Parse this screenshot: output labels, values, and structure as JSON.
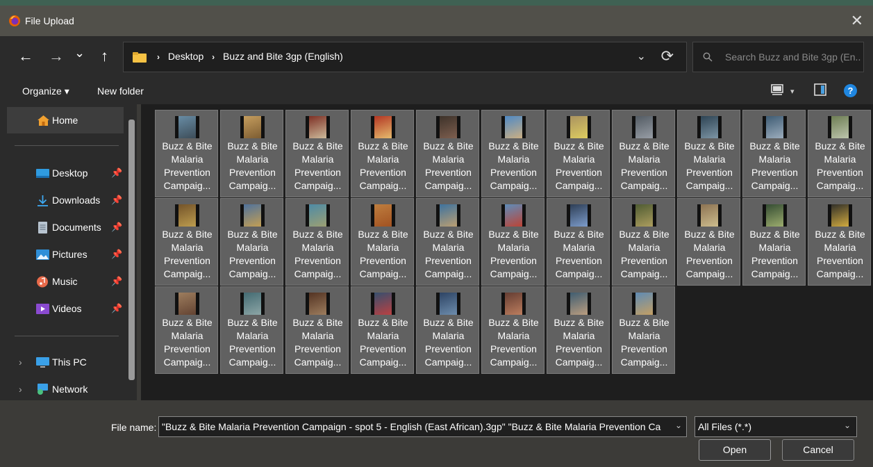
{
  "window": {
    "title": "File Upload",
    "close_glyph": "✕"
  },
  "nav": {
    "back": "←",
    "forward": "→",
    "recent": "⌄",
    "up": "↑"
  },
  "address": {
    "crumbs": [
      "Desktop",
      "Buzz and Bite 3gp (English)"
    ],
    "sep": "›",
    "dropdown_glyph": "⌄",
    "refresh_glyph": "⟳"
  },
  "search": {
    "placeholder": "Search Buzz and Bite 3gp (En..."
  },
  "toolbar": {
    "organize": "Organize ▾",
    "new_folder": "New folder",
    "view_caret": "▾",
    "help": "?"
  },
  "sidebar": {
    "home": "Home",
    "pinned": [
      {
        "label": "Desktop",
        "icon": "desktop-icon"
      },
      {
        "label": "Downloads",
        "icon": "downloads-icon"
      },
      {
        "label": "Documents",
        "icon": "documents-icon"
      },
      {
        "label": "Pictures",
        "icon": "pictures-icon"
      },
      {
        "label": "Music",
        "icon": "music-icon"
      },
      {
        "label": "Videos",
        "icon": "videos-icon"
      }
    ],
    "pin_glyph": "📌",
    "expand_glyph": "›",
    "this_pc": "This PC",
    "network": "Network"
  },
  "files": {
    "caption_lines": [
      "Buzz & Bite",
      "Malaria",
      "Prevention",
      "Campaig..."
    ],
    "count": 30,
    "thumb_colors": [
      [
        "#6a8fa8",
        "#3b4a55"
      ],
      [
        "#c8a060",
        "#7a5a30"
      ],
      [
        "#7a2a20",
        "#d0c0a0"
      ],
      [
        "#b03020",
        "#e8c070"
      ],
      [
        "#3a3028",
        "#806050"
      ],
      [
        "#4a88c8",
        "#d0b080"
      ],
      [
        "#a89060",
        "#e0d060"
      ],
      [
        "#505860",
        "#9aa0a8"
      ],
      [
        "#2a4050",
        "#8098a8"
      ],
      [
        "#3a5870",
        "#a0b0c0"
      ],
      [
        "#6a7a50",
        "#c0c8b0"
      ],
      [
        "#705028",
        "#c0a050"
      ],
      [
        "#4a70a0",
        "#c8a050"
      ],
      [
        "#4a8aa8",
        "#a0a070"
      ],
      [
        "#c08040",
        "#a05020"
      ],
      [
        "#3870a0",
        "#c0a070"
      ],
      [
        "#5a90c0",
        "#c04030"
      ],
      [
        "#2a3a50",
        "#80a0d0"
      ],
      [
        "#4a5830",
        "#b0a060"
      ],
      [
        "#8a7050",
        "#d0c090"
      ],
      [
        "#304830",
        "#a0b070"
      ],
      [
        "#2a2a28",
        "#d8b040"
      ],
      [
        "#a08060",
        "#604030"
      ],
      [
        "#406870",
        "#90a8a8"
      ],
      [
        "#503020",
        "#a08060"
      ],
      [
        "#305070",
        "#c04040"
      ],
      [
        "#2a4060",
        "#7090b0"
      ],
      [
        "#603a30",
        "#c08060"
      ],
      [
        "#3a5a70",
        "#c0a080"
      ],
      [
        "#5a8ab8",
        "#c8a060"
      ]
    ],
    "selected": true
  },
  "footer": {
    "file_name_label": "File name:",
    "file_name_value": "\"Buzz & Bite Malaria Prevention Campaign - spot 5 - English (East African).3gp\" \"Buzz & Bite Malaria Prevention Ca",
    "dropdown_glyph": "⌄",
    "file_type": "All Files (*.*)",
    "open": "Open",
    "cancel": "Cancel"
  }
}
